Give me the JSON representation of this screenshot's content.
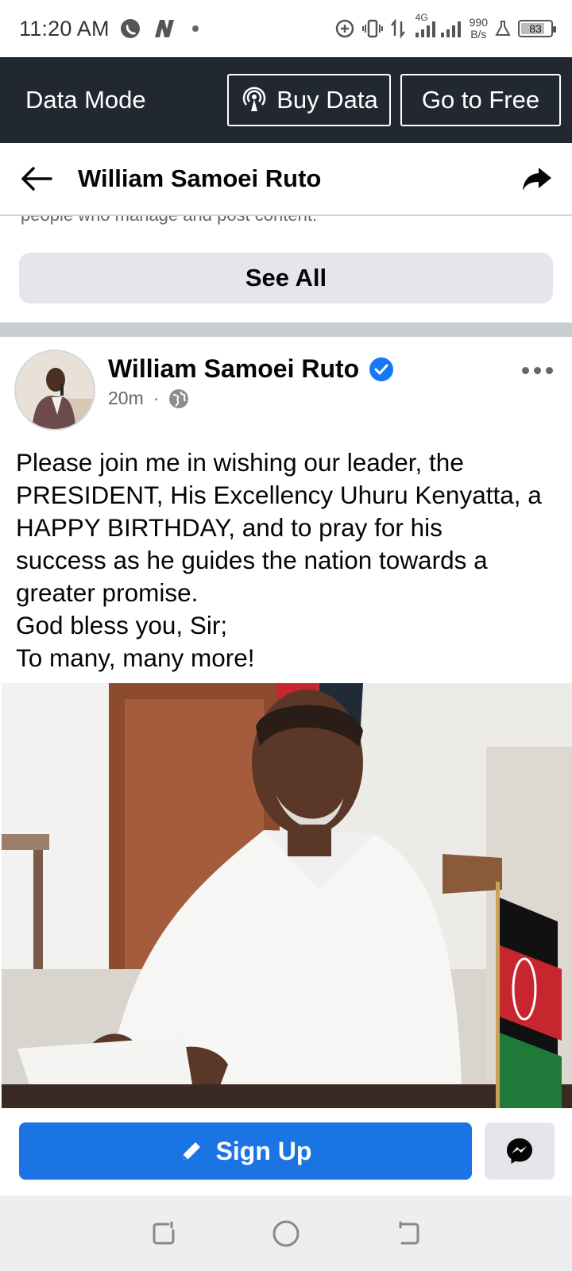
{
  "status_bar": {
    "time": "11:20 AM",
    "network": "4G",
    "speed_value": "990",
    "speed_unit": "B/s",
    "battery": "83",
    "battery_level": 0.83
  },
  "data_mode": {
    "title": "Data Mode",
    "buy_label": "Buy Data",
    "free_label": "Go to Free"
  },
  "header": {
    "title": "William Samoei Ruto"
  },
  "page_section": {
    "peek_text": "people who manage and post content.",
    "see_all_label": "See All"
  },
  "post": {
    "author": "William Samoei Ruto",
    "time": "20m",
    "separator": "·",
    "text_lines": [
      "Please join me in wishing our leader, the",
      "PRESIDENT, His Excellency Uhuru Kenyatta, a",
      "HAPPY BIRTHDAY, and to pray for his",
      "success as he guides the nation towards a",
      "greater promise.",
      "God bless you, Sir;",
      "To many, many more!"
    ]
  },
  "bottom_bar": {
    "signup_label": "Sign Up"
  },
  "colors": {
    "accent": "#1b74e4",
    "data_bar": "#222831",
    "verified": "#1877f2"
  }
}
